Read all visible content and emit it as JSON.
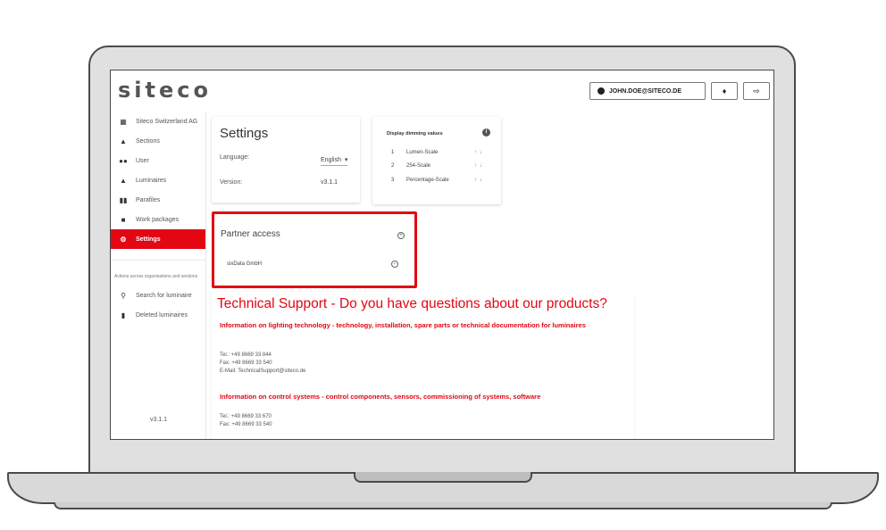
{
  "header": {
    "logo": "siteco",
    "user_email": "JOHN.DOE@SITECO.DE",
    "bell_icon": "bell-icon",
    "logout_icon": "logout-icon"
  },
  "sidebar": {
    "items": [
      {
        "label": "Siteco Switzerland AG",
        "icon": "building-icon",
        "active": false
      },
      {
        "label": "Sections",
        "icon": "hierarchy-icon",
        "active": false
      },
      {
        "label": "User",
        "icon": "users-icon",
        "active": false
      },
      {
        "label": "Luminaires",
        "icon": "lamp-icon",
        "active": false
      },
      {
        "label": "Parafiles",
        "icon": "files-icon",
        "active": false
      },
      {
        "label": "Work packages",
        "icon": "briefcase-icon",
        "active": false
      },
      {
        "label": "Settings",
        "icon": "gear-icon",
        "active": true
      }
    ],
    "section_label": "Actions across organisations and sections",
    "section_items": [
      {
        "label": "Search for luminaire",
        "icon": "search-icon"
      },
      {
        "label": "Deleted luminaires",
        "icon": "trash-icon"
      }
    ],
    "version": "v3.1.1"
  },
  "settings": {
    "title": "Settings",
    "language_label": "Language:",
    "language_value": "English",
    "version_label": "Version:",
    "version_value": "v3.1.1"
  },
  "dimming": {
    "title": "Display dimming values",
    "rows": [
      {
        "num": "1",
        "name": "Lumen-Scale"
      },
      {
        "num": "2",
        "name": "254-Scale"
      },
      {
        "num": "3",
        "name": "Percentage-Scale"
      }
    ]
  },
  "partner": {
    "title": "Partner access",
    "item": "sixData GmbH"
  },
  "support": {
    "title": "Technical Support - Do you have questions about our products?",
    "lighting_heading": "Information on lighting technology - technology, installation, spare parts or technical documentation for luminaires",
    "lighting_tel": "Tel.: +49 8669 33 844",
    "lighting_fax": "Fax: +49 8669 33 540",
    "lighting_email": "E-Mail: TechnicalSupport@siteco.de",
    "control_heading": "Information on control systems - control components, sensors, commissioning of systems, software",
    "control_tel": "Tel.: +49 8669 33 670",
    "control_fax": "Fax: +49 8669 33 540"
  },
  "colors": {
    "accent": "#e30613"
  }
}
